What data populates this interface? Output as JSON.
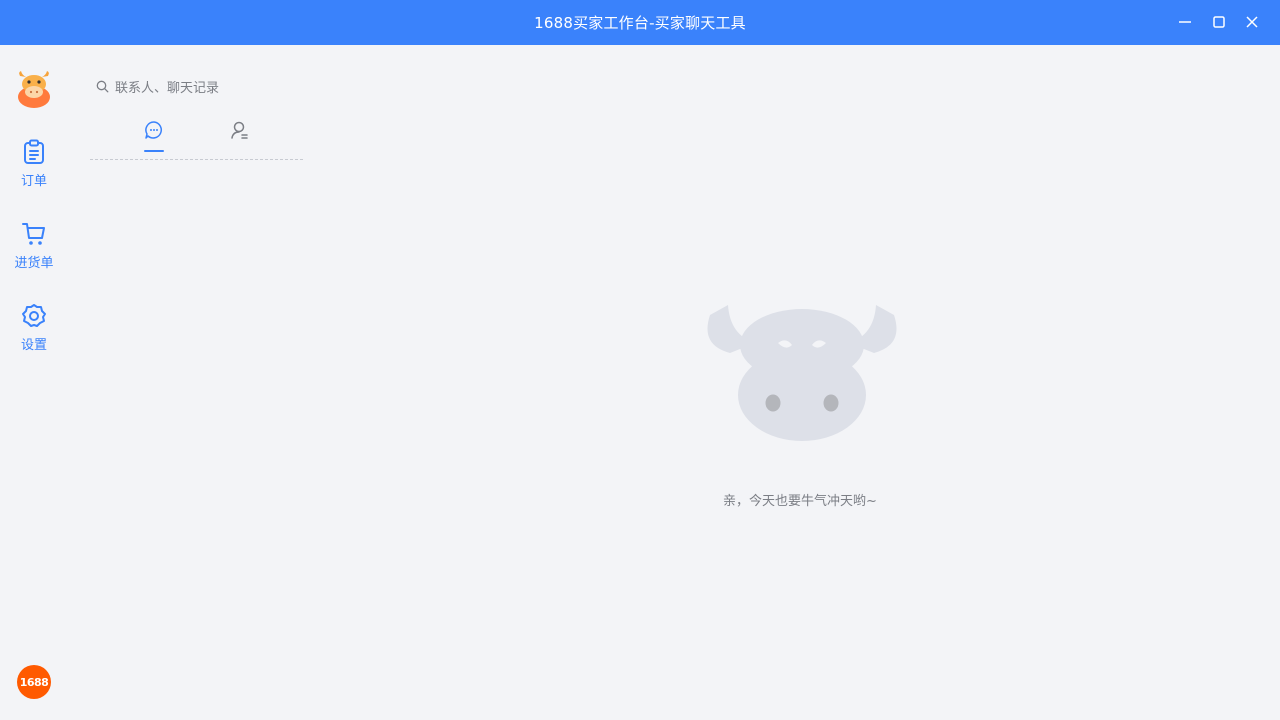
{
  "window": {
    "title": "1688买家工作台-买家聊天工具",
    "controls": [
      "minimize-icon",
      "maximize-icon",
      "close-icon"
    ]
  },
  "sidebar": {
    "avatar": "cow-avatar",
    "items": [
      {
        "label": "订单",
        "icon": "clipboard-icon"
      },
      {
        "label": "进货单",
        "icon": "cart-icon"
      },
      {
        "label": "设置",
        "icon": "gear-icon"
      }
    ],
    "brand_logo": "1688"
  },
  "search": {
    "placeholder": "联系人、聊天记录",
    "icon": "search-icon"
  },
  "tabs": [
    {
      "name": "chat",
      "icon": "chat-bubble-icon",
      "active": true
    },
    {
      "name": "contacts",
      "icon": "contact-list-icon",
      "active": false
    }
  ],
  "empty_state": {
    "message": "亲，今天也要牛气冲天哟~",
    "illustration": "cow-mascot"
  },
  "colors": {
    "accent": "#3a82fb",
    "brand_orange": "#ff5a00",
    "background": "#f3f4f7",
    "muted_text": "#7b7e85"
  }
}
